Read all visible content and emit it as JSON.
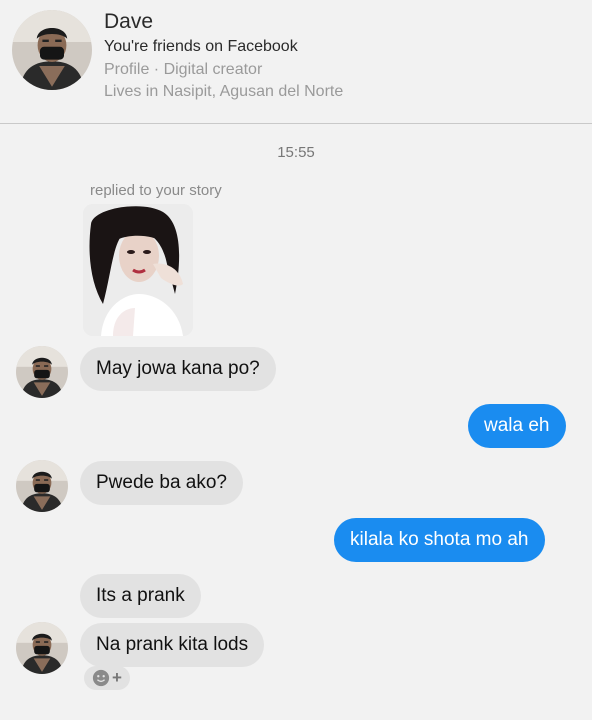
{
  "contact": {
    "name": "Dave",
    "friends_text": "You're friends on Facebook",
    "profile_line": "Profile · Digital creator",
    "location_line": "Lives in Nasipit, Agusan del Norte"
  },
  "thread": {
    "timestamp": "15:55",
    "story_reply_label": "replied to your story",
    "messages": [
      {
        "from": "them",
        "text": "May jowa kana po?"
      },
      {
        "from": "me",
        "text": "wala eh"
      },
      {
        "from": "them",
        "text": "Pwede ba ako?"
      },
      {
        "from": "me",
        "text": "kilala ko shota mo ah"
      },
      {
        "from": "them",
        "text": "Its a prank"
      },
      {
        "from": "them",
        "text": "Na prank kita lods"
      }
    ]
  },
  "icons": {
    "reaction": "smiley-face-icon",
    "add_reaction": "plus-icon",
    "reaction_plus_glyph": "+"
  },
  "colors": {
    "background": "#f2f2f2",
    "incoming_bubble": "#e2e2e2",
    "outgoing_bubble": "#1a8cf0"
  }
}
